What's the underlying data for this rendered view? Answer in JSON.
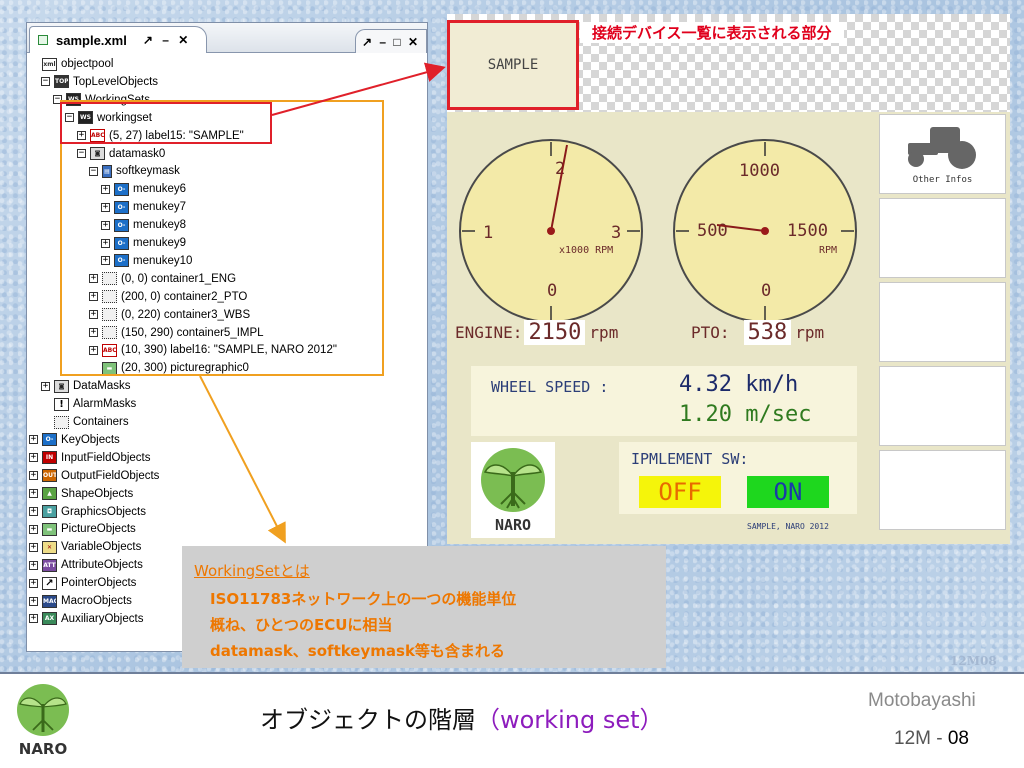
{
  "tree_window": {
    "tab_title": "sample.xml",
    "tab_controls": "↗ – ✕",
    "second_tab_controls": "↗ – □ ✕",
    "nodes": [
      {
        "label": "objectpool",
        "icon": "xml"
      },
      {
        "label": "TopLevelObjects",
        "icon": "TOP"
      },
      {
        "label": "WorkingSets",
        "icon": "WS"
      },
      {
        "label": "workingset",
        "icon": "WS"
      },
      {
        "label": "(5, 27) label15: \"SAMPLE\"",
        "icon": "ABC"
      },
      {
        "label": "datamask0",
        "icon": "DM"
      },
      {
        "label": "softkeymask",
        "icon": "SK"
      },
      {
        "label": "menukey6",
        "icon": "KEY"
      },
      {
        "label": "menukey7",
        "icon": "KEY"
      },
      {
        "label": "menukey8",
        "icon": "KEY"
      },
      {
        "label": "menukey9",
        "icon": "KEY"
      },
      {
        "label": "menukey10",
        "icon": "KEY"
      },
      {
        "label": "(0, 0) container1_ENG",
        "icon": "CONT"
      },
      {
        "label": "(200, 0) container2_PTO",
        "icon": "CONT"
      },
      {
        "label": "(0, 220) container3_WBS",
        "icon": "CONT"
      },
      {
        "label": "(150, 290) container5_IMPL",
        "icon": "CONT"
      },
      {
        "label": "(10, 390) label16: \"SAMPLE, NARO 2012\"",
        "icon": "ABC"
      },
      {
        "label": "(20, 300) picturegraphic0",
        "icon": "PIC"
      },
      {
        "label": "DataMasks",
        "icon": "DM"
      },
      {
        "label": "AlarmMasks",
        "icon": "ALARM"
      },
      {
        "label": "Containers",
        "icon": "CONT"
      },
      {
        "label": "KeyObjects",
        "icon": "KEY"
      },
      {
        "label": "InputFieldObjects",
        "icon": "IN"
      },
      {
        "label": "OutputFieldObjects",
        "icon": "OUT"
      },
      {
        "label": "ShapeObjects",
        "icon": "SHAPE"
      },
      {
        "label": "GraphicsObjects",
        "icon": "GFX"
      },
      {
        "label": "PictureObjects",
        "icon": "PIC"
      },
      {
        "label": "VariableObjects",
        "icon": "VAR"
      },
      {
        "label": "AttributeObjects",
        "icon": "ATT"
      },
      {
        "label": "PointerObjects",
        "icon": "PTR"
      },
      {
        "label": "MacroObjects",
        "icon": "MAC"
      },
      {
        "label": "AuxiliaryObjects",
        "icon": "AUX"
      }
    ]
  },
  "terminal": {
    "device_label": "SAMPLE",
    "device_caption": "接続デバイス一覧に表示される部分",
    "engine_gauge": {
      "ticks": [
        "2",
        "1",
        "3",
        "0"
      ],
      "unit": "x1000 RPM"
    },
    "pto_gauge": {
      "ticks": [
        "1000",
        "500",
        "1500",
        "0"
      ],
      "unit": "RPM"
    },
    "engine_label": "ENGINE:",
    "engine_value": "2150",
    "engine_unit": "rpm",
    "pto_label": "PTO:",
    "pto_value": "538",
    "pto_unit": "rpm",
    "wheel_label": "WHEEL SPEED :",
    "wheel_kmh_value": "4.32",
    "wheel_kmh_unit": "km/h",
    "wheel_ms_value": "1.20",
    "wheel_ms_unit": "m/sec",
    "logo_text": "NARO",
    "implement_title": "IPMLEMENT SW:",
    "btn_off": "OFF",
    "btn_on": "ON",
    "footer": "SAMPLE, NARO 2012",
    "softkey_other": "Other Infos"
  },
  "note": {
    "title": "WorkingSetとは",
    "lines": [
      "ISO11783ネットワーク上の一つの機能単位",
      "概ね、ひとつのECUに相当",
      "datamask、softkeymask等も含まれる"
    ]
  },
  "slide": {
    "id_mark": "12M08",
    "title_main": "オブジェクトの階層",
    "title_highlight": "（working set）",
    "author": "Motobayashi",
    "page_prefix": "12M - ",
    "page_number": "08",
    "logo_text": "NARO"
  },
  "colors": {
    "accent_red": "#e0202a",
    "accent_orange": "#f0a020",
    "note_text": "#ee7700",
    "title_highlight": "#8d1cbd"
  }
}
